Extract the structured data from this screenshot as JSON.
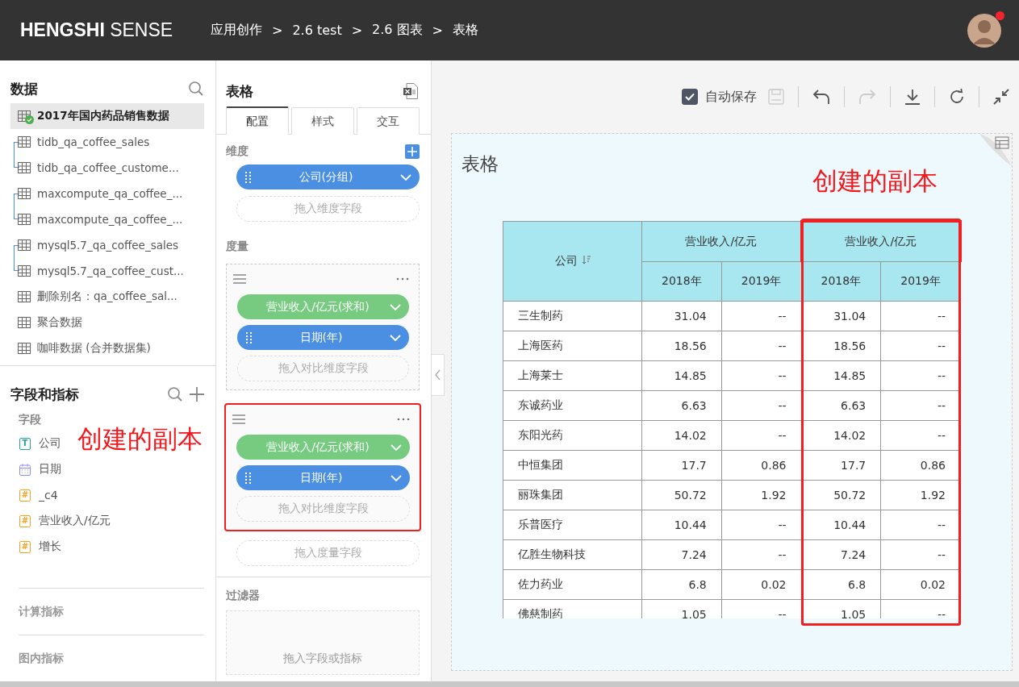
{
  "header": {
    "logo_bold": "HENGSHI",
    "logo_light": "SENSE",
    "separator": ">",
    "breadcrumb": [
      "应用创作",
      "2.6 test",
      "2.6 图表",
      "表格"
    ],
    "notification_dot": true
  },
  "data_panel": {
    "title": "数据",
    "sources": [
      {
        "kind": "single",
        "label": "2017年国内药品销售数据",
        "selected": true,
        "synced": true
      },
      {
        "kind": "group",
        "children": [
          {
            "label": "tidb_qa_coffee_sales",
            "selected": false
          },
          {
            "label": "tidb_qa_coffee_custome...",
            "selected": false
          }
        ]
      },
      {
        "kind": "group",
        "children": [
          {
            "label": "maxcompute_qa_coffee_...",
            "selected": false
          },
          {
            "label": "maxcompute_qa_coffee_...",
            "selected": false
          }
        ]
      },
      {
        "kind": "group",
        "children": [
          {
            "label": "mysql5.7_qa_coffee_sales",
            "selected": false
          },
          {
            "label": "mysql5.7_qa_coffee_cust...",
            "selected": false
          }
        ]
      },
      {
        "kind": "single",
        "label": "删除别名：qa_coffee_sal...",
        "selected": false,
        "synced": false
      },
      {
        "kind": "single",
        "label": "聚合数据",
        "selected": false,
        "synced": false
      },
      {
        "kind": "single",
        "label": "咖啡数据 (合并数据集)",
        "selected": false,
        "synced": false
      }
    ]
  },
  "fields_panel": {
    "title": "字段和指标",
    "subtitle": "字段",
    "fields": [
      {
        "kind": "text",
        "icon": "T",
        "label": "公司"
      },
      {
        "kind": "date",
        "label": "日期"
      },
      {
        "kind": "number",
        "icon": "#",
        "label": "_c4"
      },
      {
        "kind": "number",
        "icon": "#",
        "label": "营业收入/亿元"
      },
      {
        "kind": "number",
        "icon": "#",
        "label": "增长"
      }
    ],
    "sections": [
      "计算指标",
      "图内指标"
    ]
  },
  "config_panel": {
    "title": "表格",
    "tabs": [
      {
        "label": "配置",
        "selected": true
      },
      {
        "label": "样式",
        "selected": false
      },
      {
        "label": "交互",
        "selected": false
      }
    ],
    "dimension": {
      "label": "维度",
      "pills": [
        {
          "kind": "dimension",
          "label": "公司(分组)"
        }
      ],
      "drop": "拖入维度字段"
    },
    "measure": {
      "label": "度量",
      "groups": [
        {
          "highlighted": false,
          "pills": [
            {
              "kind": "measure",
              "label": "营业收入/亿元(求和)"
            },
            {
              "kind": "dimension",
              "label": "日期(年)"
            }
          ],
          "drop": "拖入对比维度字段"
        },
        {
          "highlighted": true,
          "pills": [
            {
              "kind": "measure",
              "label": "营业收入/亿元(求和)"
            },
            {
              "kind": "dimension",
              "label": "日期(年)"
            }
          ],
          "drop": "拖入对比维度字段"
        }
      ],
      "drop": "拖入度量字段"
    },
    "filter": {
      "label": "过滤器",
      "drop": "拖入字段或指标"
    }
  },
  "toolbar": {
    "autosave": {
      "label": "自动保存",
      "checked": true
    },
    "redo_disabled": true
  },
  "chart": {
    "title": "表格",
    "table": {
      "company_header": "公司",
      "groups": [
        {
          "label": "营业收入/亿元",
          "highlighted": false,
          "years": [
            "2018年",
            "2019年"
          ]
        },
        {
          "label": "营业收入/亿元",
          "highlighted": true,
          "years": [
            "2018年",
            "2019年"
          ]
        }
      ],
      "rows": [
        [
          "三生制药",
          "31.04",
          "--",
          "31.04",
          "--"
        ],
        [
          "上海医药",
          "18.56",
          "--",
          "18.56",
          "--"
        ],
        [
          "上海莱士",
          "14.85",
          "--",
          "14.85",
          "--"
        ],
        [
          "东诚药业",
          "6.63",
          "--",
          "6.63",
          "--"
        ],
        [
          "东阳光药",
          "14.02",
          "--",
          "14.02",
          "--"
        ],
        [
          "中恒集团",
          "17.7",
          "0.86",
          "17.7",
          "0.86"
        ],
        [
          "丽珠集团",
          "50.72",
          "1.92",
          "50.72",
          "1.92"
        ],
        [
          "乐普医疗",
          "10.44",
          "--",
          "10.44",
          "--"
        ],
        [
          "亿胜生物科技",
          "7.24",
          "--",
          "7.24",
          "--"
        ],
        [
          "佐力药业",
          "6.8",
          "0.02",
          "6.8",
          "0.02"
        ],
        [
          "佛慈制药",
          "1.05",
          "--",
          "1.05",
          "--"
        ]
      ]
    }
  },
  "annotations": {
    "table_note": "创建的副本",
    "panel_note": "创建的副本"
  }
}
